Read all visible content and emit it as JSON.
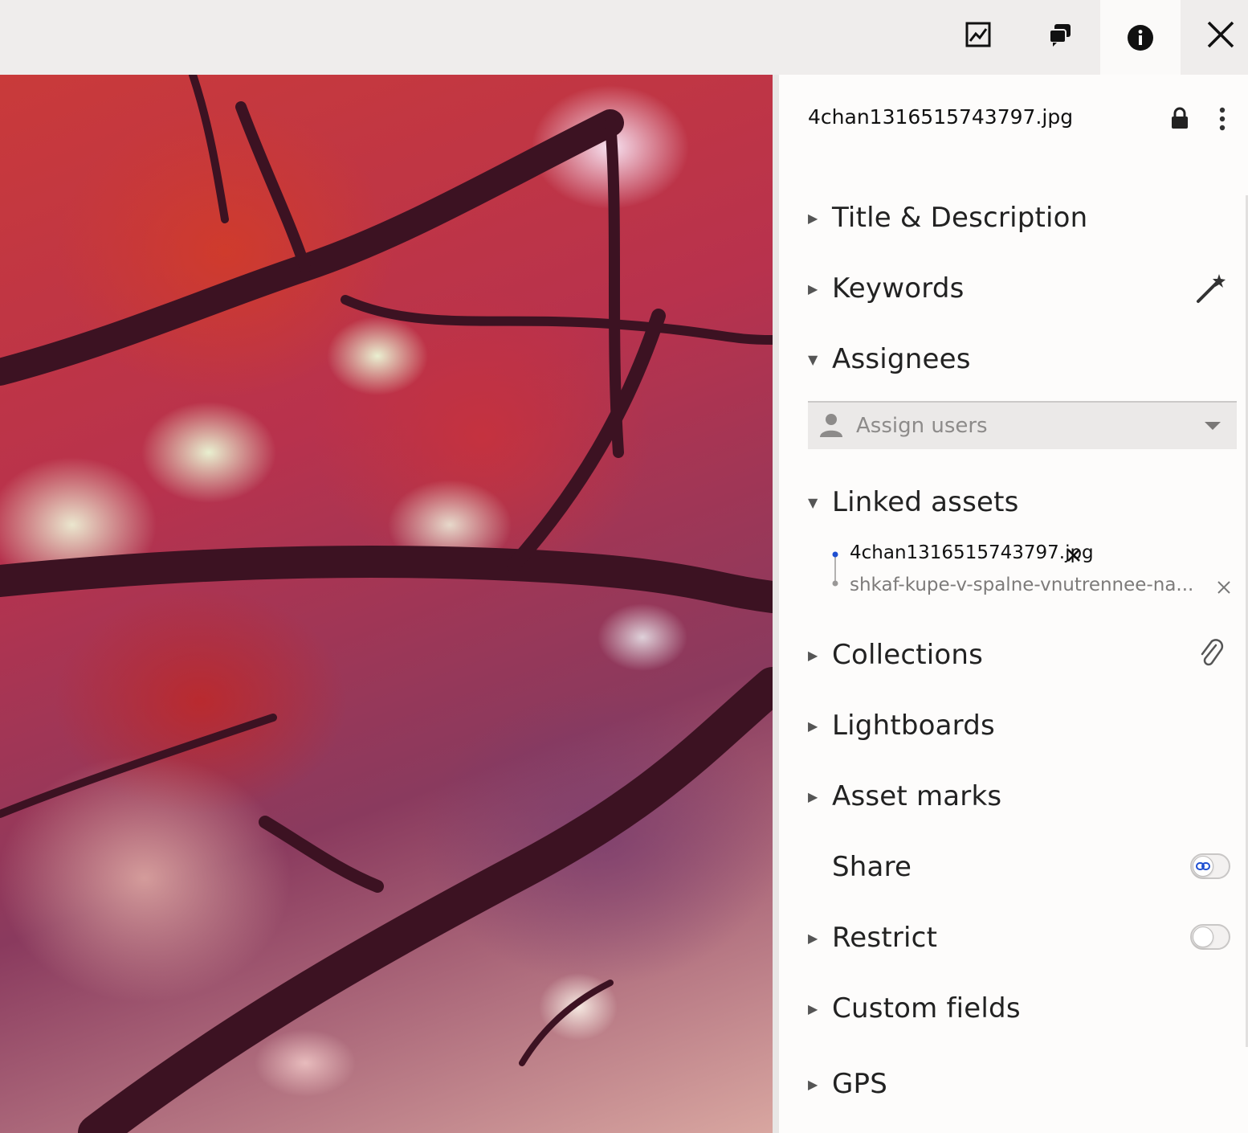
{
  "toolbar": {
    "icons": [
      "activity-chart-icon",
      "comments-icon",
      "info-icon",
      "close-icon"
    ],
    "active": "info-icon"
  },
  "panel": {
    "file_name": "4chan1316515743797.jpg",
    "sections": {
      "title_description": "Title & Description",
      "keywords": "Keywords",
      "assignees": "Assignees",
      "linked_assets": "Linked assets",
      "collections": "Collections",
      "lightboards": "Lightboards",
      "asset_marks": "Asset marks",
      "share": "Share",
      "restrict": "Restrict",
      "custom_fields": "Custom fields",
      "gps": "GPS"
    },
    "assign_placeholder": "Assign users",
    "linked_assets": [
      {
        "name": "4chan1316515743797.jpg",
        "current": true
      },
      {
        "name": "shkaf-kupe-v-spalne-vnutrennee-na...",
        "current": false
      }
    ],
    "share_enabled": false,
    "restrict_enabled": false
  },
  "colors": {
    "accent": "#1f4fd1",
    "panel_bg": "#fdfcfb",
    "topbar_bg": "#efedec"
  }
}
